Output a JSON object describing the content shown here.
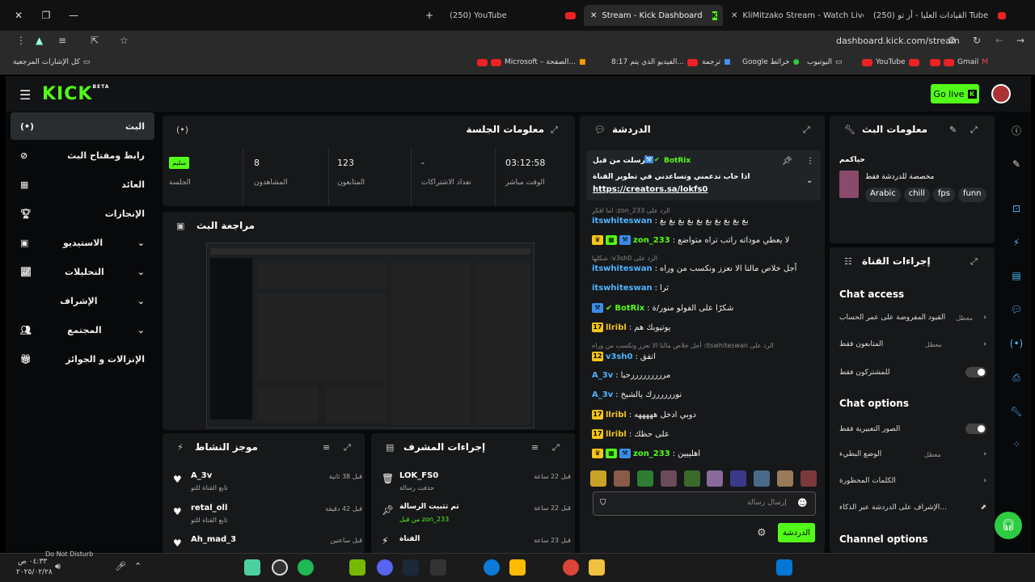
{
  "browser": {
    "tabs": [
      {
        "label": "(250) YouTube",
        "icon": "youtube-icon"
      },
      {
        "label": "Stream - Kick Dashboard",
        "icon": "kick-icon",
        "active": true
      },
      {
        "label": "KliMitzako Stream - Watch Live",
        "icon": "kick-icon"
      },
      {
        "label": "(250) القيادات العليا - أر تو Tube",
        "icon": "youtube-icon"
      }
    ],
    "url": "dashboard.kick.com/stream",
    "bookmarks": [
      {
        "label": "كل الإشارات المرجعية"
      },
      {
        "label": "Microsoft – الصفحة..."
      },
      {
        "label": "8:17 الفيديو الذي يتم..."
      },
      {
        "label": "ترجمة"
      },
      {
        "label": "Google خرائط"
      },
      {
        "label": "اليوتيوب"
      },
      {
        "label": "YouTube"
      },
      {
        "label": "Gmail"
      }
    ]
  },
  "kick": {
    "logo": "KICK",
    "logo_beta": "BETA",
    "go_live": "Go live",
    "sidebar": [
      {
        "label": "البث",
        "icon": "broadcast-icon",
        "active": true
      },
      {
        "label": "رابط ومفتاح البث",
        "icon": "link-icon"
      },
      {
        "label": "العائد",
        "icon": "revenue-icon"
      },
      {
        "label": "الإنجازات",
        "icon": "trophy-icon"
      },
      {
        "label": "الاستيديو",
        "icon": "studio-icon"
      },
      {
        "label": "التحليلات",
        "icon": "analytics-icon"
      },
      {
        "label": "الإشراف",
        "icon": "moderation-icon"
      },
      {
        "label": "المجتمع",
        "icon": "community-icon"
      },
      {
        "label": "الإنزالات و الجوائز",
        "icon": "drops-icon"
      }
    ],
    "session": {
      "title": "معلومات الجلسة",
      "stats": [
        {
          "value": "سليم",
          "label": "الجلسة"
        },
        {
          "value": "8",
          "label": "المشاهدون"
        },
        {
          "value": "123",
          "label": "المتابعون"
        },
        {
          "value": "-",
          "label": "تعداد الاشتراكات"
        },
        {
          "value": "03:12:58",
          "label": "الوقت مباشر"
        }
      ]
    },
    "preview": {
      "title": "مراجعة البث"
    },
    "activity": {
      "title": "موجز النشاط",
      "items": [
        {
          "user": "A_3v",
          "action": "تابع القناة للتو",
          "time": "قبل 38 ثانية"
        },
        {
          "user": "retal_oll",
          "action": "تابع القناة للتو",
          "time": "قبل 42 دقيقة"
        },
        {
          "user": "Ah_mad_3",
          "action": "",
          "time": "قبل ساعتين"
        }
      ]
    },
    "modactions": {
      "title": "إجراءات المشرف",
      "items": [
        {
          "user": "LOK_FS0",
          "action": "حذفت رسالة",
          "time": "قبل 22 ساعة"
        },
        {
          "user": "تم تثبيت الرسالة",
          "action": "من قبل zon_233",
          "time": "قبل 22 ساعة"
        },
        {
          "user": "القناة",
          "action": "",
          "time": "قبل 23 ساعة"
        }
      ]
    },
    "chat": {
      "title": "الدردشة",
      "pinned": {
        "by": "أرسلت من قبل",
        "user": "BotRix",
        "text": "اذا حاب تدعمني وتساعدني في تطوير القناة",
        "link": "https://creators.sa/lokfs0"
      },
      "messages": [
        {
          "reply": "اما افكر :zon_233 الرد على",
          "user": "itswhiteswan",
          "text": "بغ بغ بغ بغ بغ بغ بغ بغ بغ بغ"
        },
        {
          "user": "zon_233",
          "text": "لا يعطي موداته راتب تراه متواضع"
        },
        {
          "reply": "شكلها :v3sh0 الرد على",
          "user": "itswhiteswan",
          "text": "أجل خلاص مالنا الا نعزز ونكسب من وراه"
        },
        {
          "user": "itswhiteswan",
          "text": "ثرا"
        },
        {
          "user": "BotRix",
          "text": "شكرًا على الفولو منور/ة"
        },
        {
          "user": "llribl",
          "text": "يوتيوبك هم"
        },
        {
          "reply": "أجل خلاص مالنا الا نعزز ونكسب من وراه :itswhiteswan الرد على",
          "user": "v3sh0",
          "text": "اتفق"
        },
        {
          "user": "A_3v",
          "text": "مرررررررررحبا"
        },
        {
          "user": "A_3v",
          "text": "نوررررررك يالشيخ"
        },
        {
          "user": "llribl",
          "text": "دوبي ادخل هههههه"
        },
        {
          "user": "llribl",
          "text": "على حظك"
        },
        {
          "user": "zon_233",
          "text": "اهلييين"
        }
      ],
      "input_placeholder": "إرسال رسالة",
      "send": "الدردشة"
    },
    "streaminfo": {
      "title": "معلومات البث",
      "stream_title": "حياكمم",
      "subtitle": "مخصصة للدردشة فقط",
      "tags": [
        "Arabic",
        "chill",
        "fps",
        "funn"
      ]
    },
    "channel": {
      "title": "إجراءات القناة",
      "chat_access": "Chat access",
      "access_rows": [
        {
          "label": "القيود المفروضة على عمر الحساب",
          "value": "معطل"
        },
        {
          "label": "المتابعون فقط",
          "value": "معطل"
        },
        {
          "label": "للمشتركون فقط",
          "value": ""
        }
      ],
      "chat_options": "Chat options",
      "option_rows": [
        {
          "label": "الصور التعبيرية فقط",
          "value": ""
        },
        {
          "label": "الوضع البطيء",
          "value": "معطل"
        },
        {
          "label": "الكلمات المحظورة",
          "value": ""
        },
        {
          "label": "الإشراف على الدردشة عبر الذكاء...",
          "value": ""
        }
      ],
      "channel_options": "Channel options"
    }
  },
  "taskbar": {
    "status": "Do Not Disturb",
    "time": "٠٤:٣٣ ص",
    "date": "٢٠٢٥/٠٢/٢٨"
  }
}
